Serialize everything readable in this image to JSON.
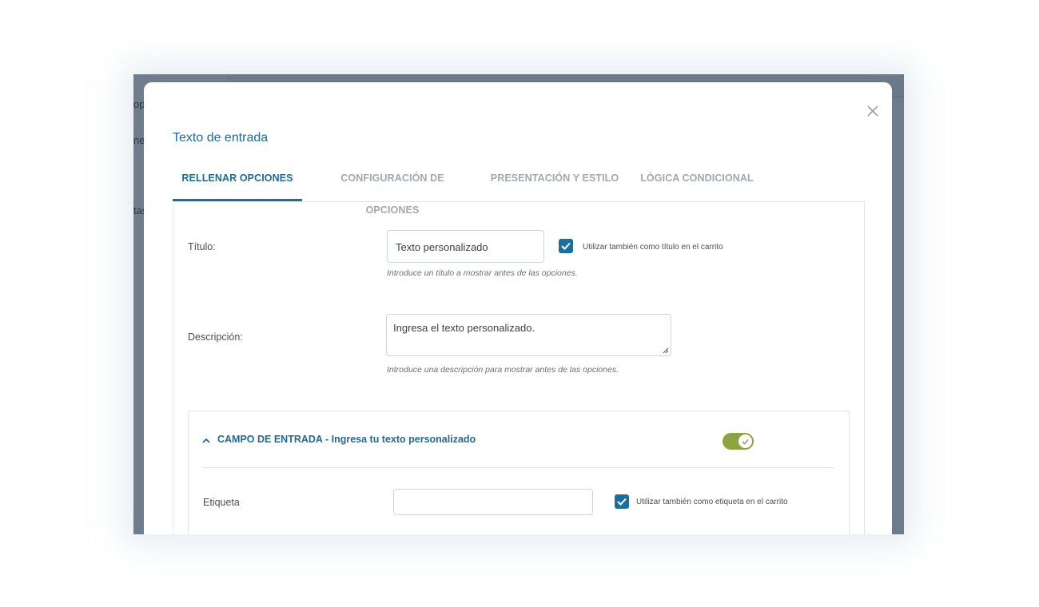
{
  "background_fragments": [
    "op",
    "ner",
    "tas"
  ],
  "modal": {
    "title": "Texto de entrada",
    "close_icon": "close-icon"
  },
  "tabs": [
    {
      "label": "RELLENAR OPCIONES",
      "active": true
    },
    {
      "label": "CONFIGURACIÓN DE OPCIONES",
      "active": false
    },
    {
      "label": "PRESENTACIÓN Y ESTILO",
      "active": false
    },
    {
      "label": "LÓGICA CONDICIONAL",
      "active": false
    }
  ],
  "form": {
    "title_label": "Título:",
    "title_value": "Texto personalizado",
    "title_cart_checkbox_label": "Utilizar también como título en el carrito",
    "title_cart_checked": true,
    "title_help": "Introduce un título a mostrar antes de las opciones.",
    "description_label": "Descripción:",
    "description_value": "Ingresa el texto personalizado.",
    "description_help": "Introduce una descripción para mostrar antes de las opciones."
  },
  "input_field": {
    "header": "CAMPO DE ENTRADA - Ingresa tu texto personalizado",
    "expanded": true,
    "enabled": true,
    "label_label": "Etiqueta",
    "label_value": "",
    "label_cart_checkbox_label": "Utilizar también como etiqueta en el carrito",
    "label_cart_checked": true
  },
  "colors": {
    "accent": "#1b6f9e",
    "toggle_on": "#8ca43f",
    "backdrop": "#6d7c8c"
  }
}
